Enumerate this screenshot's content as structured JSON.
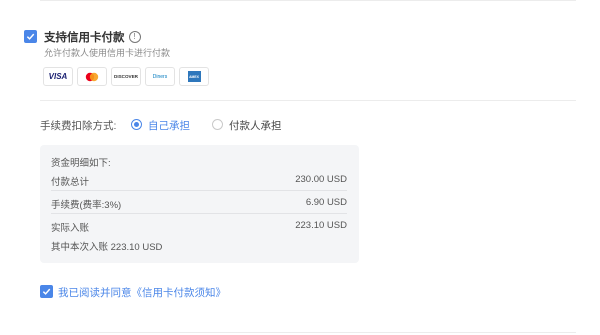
{
  "credit_card": {
    "title": "支持信用卡付款",
    "info_icon_glyph": "!",
    "description": "允许付款人使用信用卡进行付款",
    "cards": [
      {
        "name": "VISA",
        "color": "#1a1f71"
      },
      {
        "name": "mastercard",
        "color": "#eb001b"
      },
      {
        "name": "DISCOVER",
        "color": "#333333"
      },
      {
        "name": "Diners",
        "color": "#0079be"
      },
      {
        "name": "AMEX",
        "color": "#2e77bc"
      }
    ]
  },
  "fee_method": {
    "label": "手续费扣除方式:",
    "options": [
      {
        "label": "自己承担",
        "selected": true
      },
      {
        "label": "付款人承担",
        "selected": false
      }
    ]
  },
  "breakdown": {
    "heading": "资金明细如下:",
    "rows": [
      {
        "label": "付款总计",
        "value": "230.00 USD"
      },
      {
        "label": "手续费(费率:3%)",
        "value": "6.90 USD"
      },
      {
        "label": "实际入账",
        "value": "223.10 USD"
      }
    ],
    "note": "其中本次入账 223.10 USD"
  },
  "agreement": {
    "text": "我已阅读并同意《信用卡付款须知》"
  },
  "colors": {
    "accent": "#4a86e8"
  }
}
